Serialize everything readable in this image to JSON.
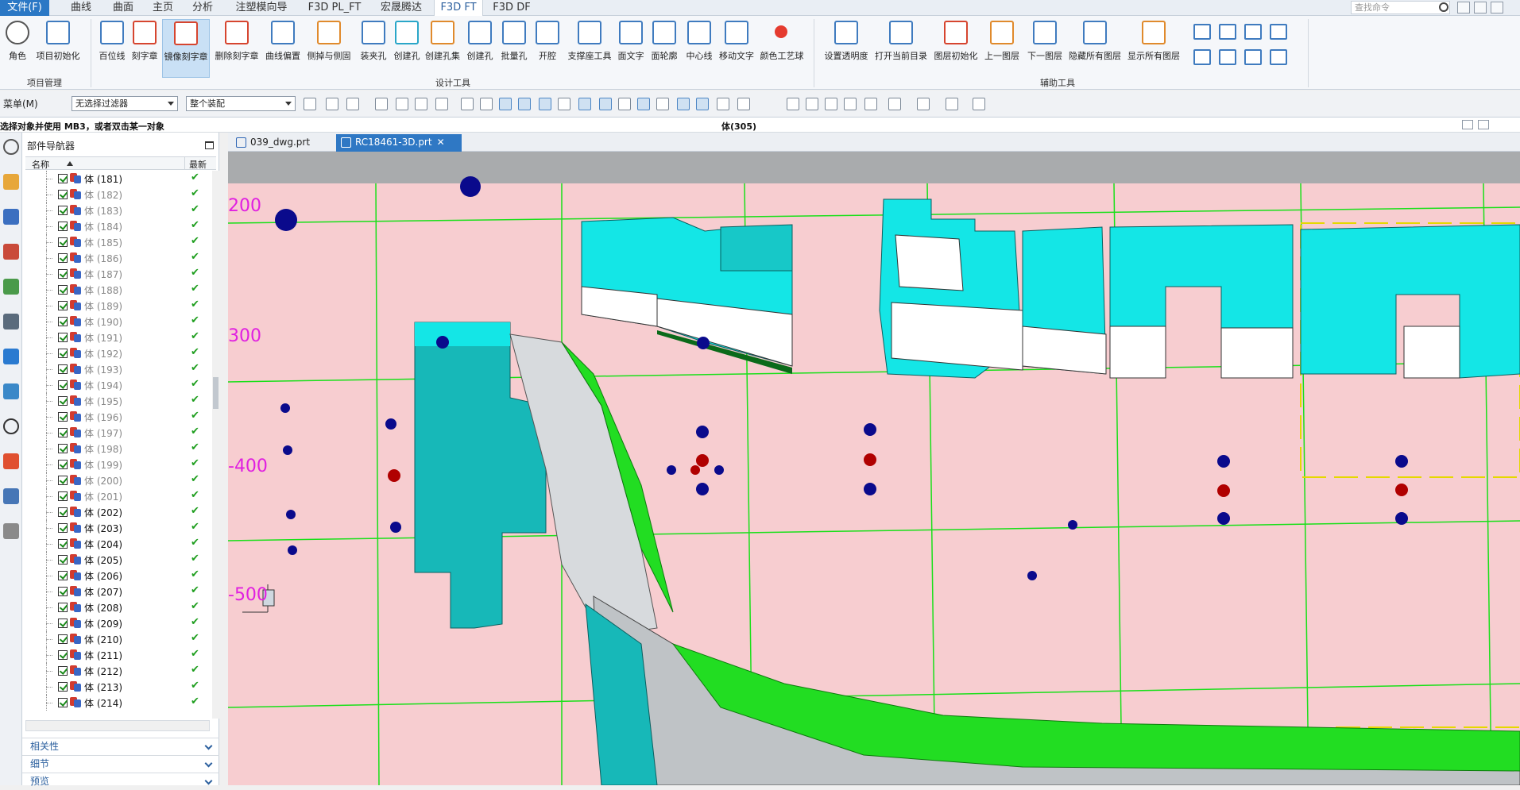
{
  "menubar": {
    "file": "文件(F)",
    "tabs": [
      "曲线",
      "曲面",
      "主页",
      "分析",
      "注塑模向导",
      "F3D PL_FT",
      "宏晟腾达",
      "F3D FT",
      "F3D DF"
    ],
    "active_tab": "F3D FT",
    "search_placeholder": "查找命令"
  },
  "ribbon": {
    "project_group": {
      "label": "项目管理",
      "buttons": [
        "角色",
        "项目初始化"
      ]
    },
    "design_group": {
      "label": "设计工具",
      "buttons": [
        "百位线",
        "刻字章",
        "镜像刻字章",
        "删除刻字章",
        "曲线偏置",
        "侧掉与侧固",
        "装夹孔",
        "创建孔",
        "创建孔集",
        "创建孔",
        "批量孔",
        "开腔",
        "支撑座工具",
        "面文字",
        "面轮廓",
        "中心线",
        "移动文字",
        "颜色工艺球"
      ],
      "selected": "镜像刻字章"
    },
    "aux_group": {
      "label": "辅助工具",
      "buttons": [
        "设置透明度",
        "打开当前目录",
        "图层初始化",
        "上一图层",
        "下一图层",
        "隐藏所有图层",
        "显示所有图层"
      ]
    }
  },
  "toolbar": {
    "menu_label": "菜单(M)",
    "filter_value": "无选择过滤器",
    "assembly_value": "整个装配"
  },
  "status": {
    "prompt": "选择对象并使用 MB3，或者双击某一对象",
    "object": "体(305)"
  },
  "navigator": {
    "title": "部件导航器",
    "col_name": "名称",
    "col_latest": "最新",
    "rows": [
      {
        "name": "体 (181)",
        "dim": false
      },
      {
        "name": "体 (182)",
        "dim": true
      },
      {
        "name": "体 (183)",
        "dim": true
      },
      {
        "name": "体 (184)",
        "dim": true
      },
      {
        "name": "体 (185)",
        "dim": true
      },
      {
        "name": "体 (186)",
        "dim": true
      },
      {
        "name": "体 (187)",
        "dim": true
      },
      {
        "name": "体 (188)",
        "dim": true
      },
      {
        "name": "体 (189)",
        "dim": true
      },
      {
        "name": "体 (190)",
        "dim": true
      },
      {
        "name": "体 (191)",
        "dim": true
      },
      {
        "name": "体 (192)",
        "dim": true
      },
      {
        "name": "体 (193)",
        "dim": true
      },
      {
        "name": "体 (194)",
        "dim": true
      },
      {
        "name": "体 (195)",
        "dim": true
      },
      {
        "name": "体 (196)",
        "dim": true
      },
      {
        "name": "体 (197)",
        "dim": true
      },
      {
        "name": "体 (198)",
        "dim": true
      },
      {
        "name": "体 (199)",
        "dim": true
      },
      {
        "name": "体 (200)",
        "dim": true
      },
      {
        "name": "体 (201)",
        "dim": true
      },
      {
        "name": "体 (202)",
        "dim": false
      },
      {
        "name": "体 (203)",
        "dim": false
      },
      {
        "name": "体 (204)",
        "dim": false
      },
      {
        "name": "体 (205)",
        "dim": false
      },
      {
        "name": "体 (206)",
        "dim": false
      },
      {
        "name": "体 (207)",
        "dim": false
      },
      {
        "name": "体 (208)",
        "dim": false
      },
      {
        "name": "体 (209)",
        "dim": false
      },
      {
        "name": "体 (210)",
        "dim": false
      },
      {
        "name": "体 (211)",
        "dim": false
      },
      {
        "name": "体 (212)",
        "dim": false
      },
      {
        "name": "体 (213)",
        "dim": false
      },
      {
        "name": "体 (214)",
        "dim": false
      }
    ],
    "sections": [
      "相关性",
      "细节",
      "预览"
    ]
  },
  "doc_tabs": [
    {
      "name": "039_dwg.prt",
      "active": false
    },
    {
      "name": "RC18461-3D.prt",
      "active": true
    }
  ],
  "viewport": {
    "y_labels": [
      "200",
      "300",
      "-400",
      "-500"
    ],
    "colors": {
      "plate": "#f7cdd0",
      "grid": "#19e019",
      "cyan": "#14e6e6",
      "teal": "#17b8b8",
      "green": "#22dd22",
      "hole": "#0a0a8c",
      "red_hole": "#b00000",
      "label": "#e020e0"
    }
  }
}
